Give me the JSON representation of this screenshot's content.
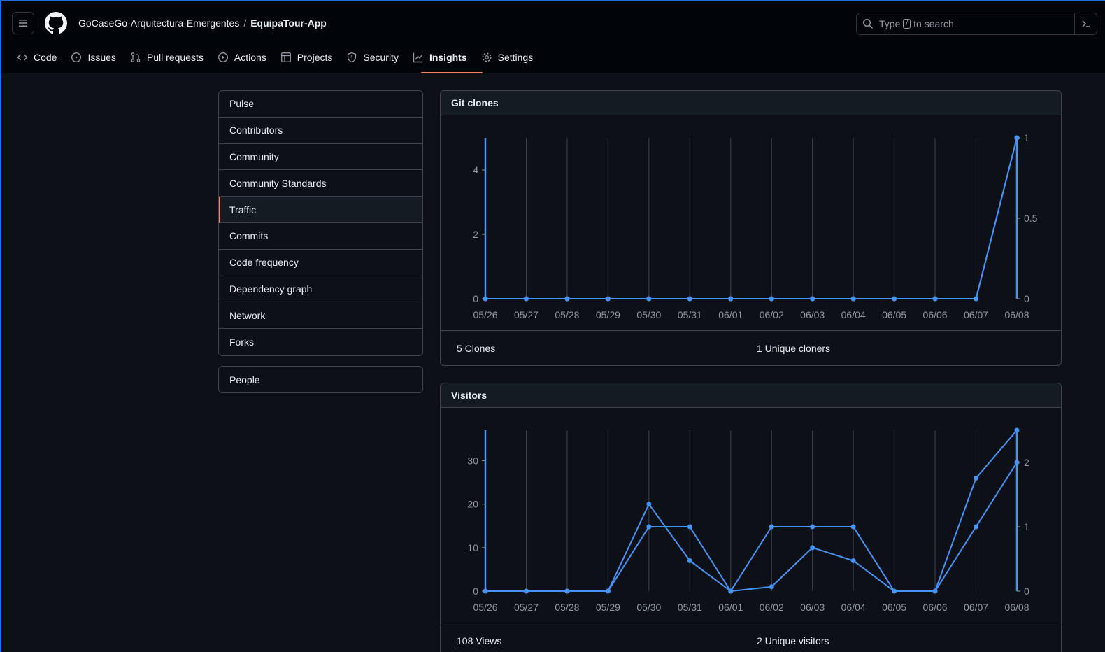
{
  "header": {
    "owner": "GoCaseGo-Arquitectura-Emergentes",
    "separator": "/",
    "repo": "EquipaTour-App",
    "search_prefix": "Type",
    "search_key": "/",
    "search_suffix": "to search"
  },
  "tabs": [
    {
      "label": "Code",
      "icon": "code-icon"
    },
    {
      "label": "Issues",
      "icon": "issue-opened-icon"
    },
    {
      "label": "Pull requests",
      "icon": "git-pull-request-icon"
    },
    {
      "label": "Actions",
      "icon": "play-icon"
    },
    {
      "label": "Projects",
      "icon": "table-icon"
    },
    {
      "label": "Security",
      "icon": "shield-icon"
    },
    {
      "label": "Insights",
      "icon": "graph-icon",
      "active": true
    },
    {
      "label": "Settings",
      "icon": "gear-icon"
    }
  ],
  "sidebar": {
    "items": [
      "Pulse",
      "Contributors",
      "Community",
      "Community Standards",
      "Traffic",
      "Commits",
      "Code frequency",
      "Dependency graph",
      "Network",
      "Forks"
    ],
    "selected": "Traffic",
    "people": "People"
  },
  "clones": {
    "title": "Git clones",
    "total_label": "5 Clones",
    "unique_label": "1 Unique cloners"
  },
  "visitors": {
    "title": "Visitors",
    "total_label": "108 Views",
    "unique_label": "2 Unique visitors"
  },
  "colors": {
    "accent": "#f78166",
    "line": "#4493f8",
    "grid": "#3d444d"
  },
  "chart_data": [
    {
      "type": "line",
      "title": "Git clones",
      "x": [
        "05/26",
        "05/27",
        "05/28",
        "05/29",
        "05/30",
        "05/31",
        "06/01",
        "06/02",
        "06/03",
        "06/04",
        "06/05",
        "06/06",
        "06/07",
        "06/08"
      ],
      "left_axis": {
        "ticks": [
          0,
          2,
          4
        ],
        "ylim": [
          0,
          5
        ]
      },
      "right_axis": {
        "ticks": [
          0,
          0.5,
          1
        ],
        "ylim": [
          0,
          1
        ]
      },
      "series": [
        {
          "axis": "left",
          "values": [
            0,
            0,
            0,
            0,
            0,
            0,
            0,
            0,
            0,
            0,
            0,
            0,
            0,
            5
          ]
        },
        {
          "axis": "right",
          "values": [
            0,
            0,
            0,
            0,
            0,
            0,
            0,
            0,
            0,
            0,
            0,
            0,
            0,
            1
          ]
        }
      ]
    },
    {
      "type": "line",
      "title": "Visitors",
      "x": [
        "05/26",
        "05/27",
        "05/28",
        "05/29",
        "05/30",
        "05/31",
        "06/01",
        "06/02",
        "06/03",
        "06/04",
        "06/05",
        "06/06",
        "06/07",
        "06/08"
      ],
      "left_axis": {
        "ticks": [
          0,
          10,
          20,
          30
        ],
        "ylim": [
          0,
          37
        ]
      },
      "right_axis": {
        "ticks": [
          0,
          1,
          2
        ],
        "ylim": [
          0,
          2.5
        ]
      },
      "series": [
        {
          "axis": "left",
          "values": [
            0,
            0,
            0,
            0,
            20,
            7,
            0,
            1,
            10,
            7,
            0,
            0,
            26,
            37
          ]
        },
        {
          "axis": "right",
          "values": [
            0,
            0,
            0,
            0,
            1,
            1,
            0,
            1,
            1,
            1,
            0,
            0,
            1,
            2
          ]
        }
      ]
    }
  ]
}
